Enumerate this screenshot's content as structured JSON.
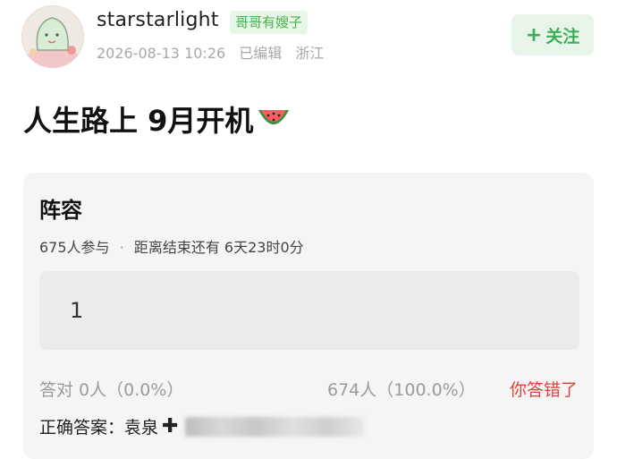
{
  "user": {
    "username": "starstarlight",
    "tag": "哥哥有嫂子",
    "date": "2026-08-13 10:26",
    "edited": "已编辑",
    "location": "浙江",
    "follow_label": "关注",
    "follow_icon": "plus-icon"
  },
  "post": {
    "title": "人生路上 9月开机",
    "emoji": "watermelon-icon"
  },
  "poll": {
    "title": "阵容",
    "participants": "675人参与",
    "separator": "·",
    "time_left": "距离结束还有 6天23时0分",
    "option_text": "1",
    "correct_text": "答对  0人（0.0%）",
    "wrong_text": "674人（100.0%）",
    "wrong_label": "你答错了",
    "answer_label": "正确答案：",
    "answer_value": "袁泉",
    "answer_plus": "✚",
    "accent_colors": {
      "follow_green": "#3fae5a",
      "tag_green": "#4caf50",
      "error_red": "#d9453a"
    }
  }
}
